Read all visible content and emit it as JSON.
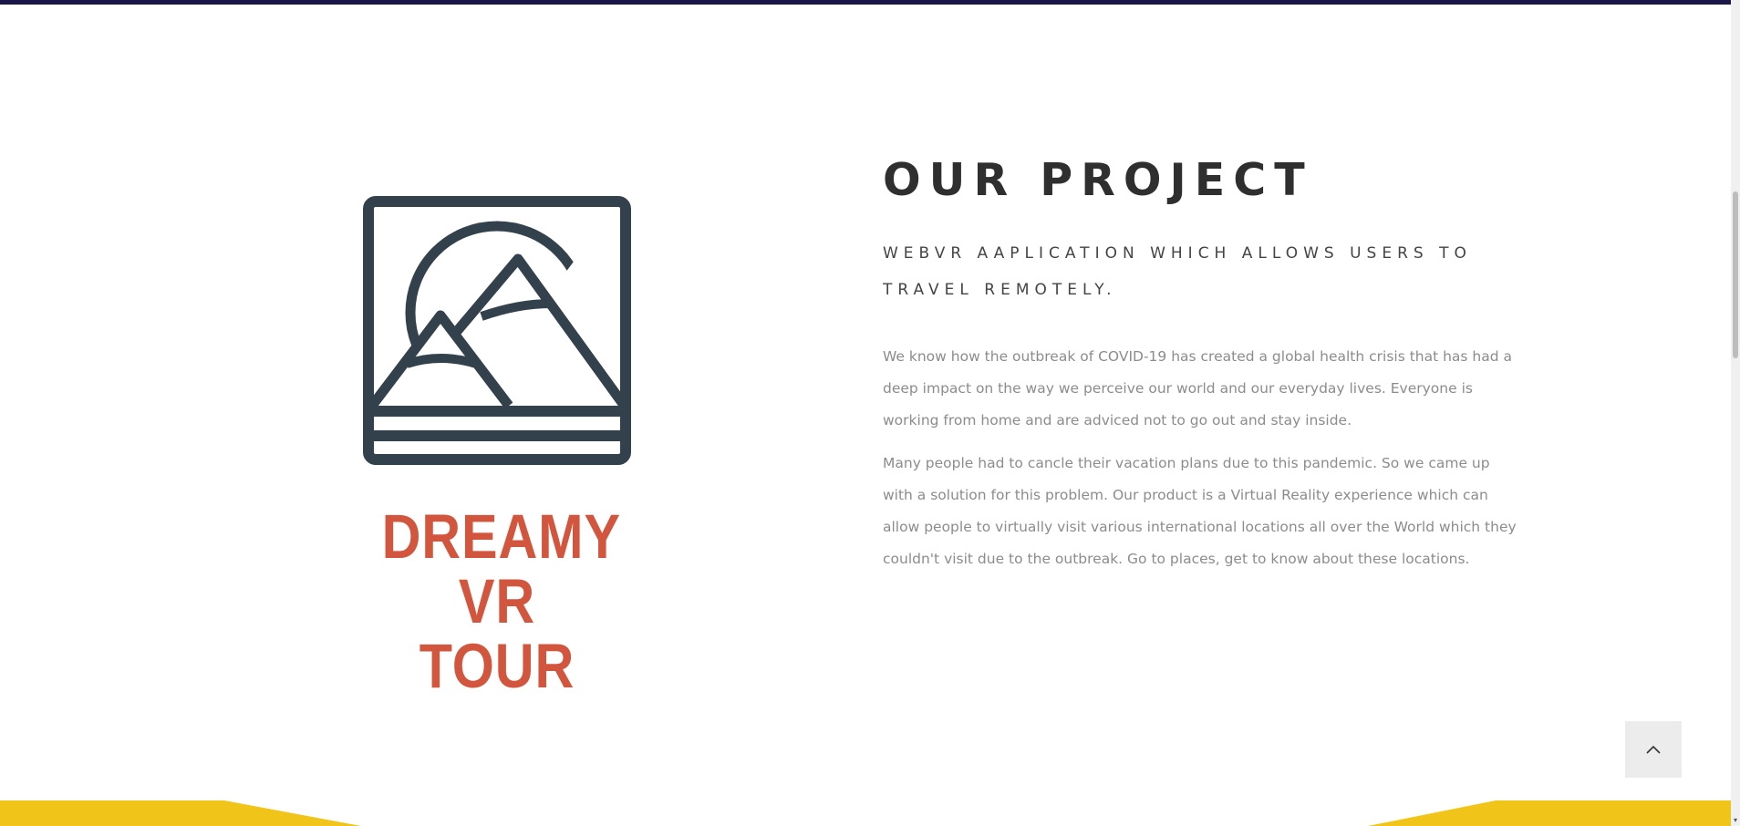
{
  "brand": {
    "line1": "DREAMY",
    "line2": "VR TOUR",
    "color": "#d2553d",
    "logo_icon": "mountain-sun-frame-icon"
  },
  "project": {
    "title": "OUR PROJECT",
    "subtitle": "WEBVR AAPLICATION WHICH ALLOWS USERS TO TRAVEL REMOTELY.",
    "paragraph1": "We know how the outbreak of COVID-19 has created a global health crisis that has had a deep impact on the way we perceive our world and our everyday lives. Everyone is working from home and are adviced not to go out and stay inside.",
    "paragraph2": "Many people had to cancle their vacation plans due to this pandemic. So we came up with a solution for this problem. Our product is a Virtual Reality experience which can allow people to virtually visit various international locations all over the World which they couldn't visit due to the outbreak. Go to places, get to know about these locations."
  },
  "controls": {
    "back_to_top_icon": "chevron-up-icon",
    "scroll_down_glyph": "▾"
  },
  "colors": {
    "header_strip": "#1b1748",
    "logo_stroke": "#33414c",
    "footer_band": "#f0c419",
    "heading": "#2f2f2f",
    "body_text": "#8c8c8c"
  }
}
